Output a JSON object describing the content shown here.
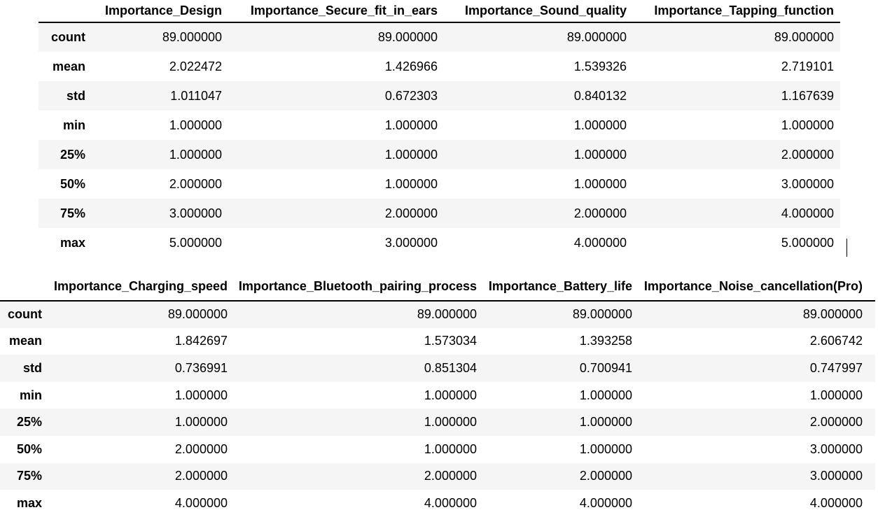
{
  "tables": [
    {
      "columns": [
        "Importance_Design",
        "Importance_Secure_fit_in_ears",
        "Importance_Sound_quality",
        "Importance_Tapping_function"
      ],
      "rows": [
        {
          "label": "count",
          "values": [
            "89.000000",
            "89.000000",
            "89.000000",
            "89.000000"
          ]
        },
        {
          "label": "mean",
          "values": [
            "2.022472",
            "1.426966",
            "1.539326",
            "2.719101"
          ]
        },
        {
          "label": "std",
          "values": [
            "1.011047",
            "0.672303",
            "0.840132",
            "1.167639"
          ]
        },
        {
          "label": "min",
          "values": [
            "1.000000",
            "1.000000",
            "1.000000",
            "1.000000"
          ]
        },
        {
          "label": "25%",
          "values": [
            "1.000000",
            "1.000000",
            "1.000000",
            "2.000000"
          ]
        },
        {
          "label": "50%",
          "values": [
            "2.000000",
            "1.000000",
            "1.000000",
            "3.000000"
          ]
        },
        {
          "label": "75%",
          "values": [
            "3.000000",
            "2.000000",
            "2.000000",
            "4.000000"
          ]
        },
        {
          "label": "max",
          "values": [
            "5.000000",
            "3.000000",
            "4.000000",
            "5.000000"
          ]
        }
      ]
    },
    {
      "columns": [
        "Importance_Charging_speed",
        "Importance_Bluetooth_pairing_process",
        "Importance_Battery_life",
        "Importance_Noise_cancellation(Pro)"
      ],
      "rows": [
        {
          "label": "count",
          "values": [
            "89.000000",
            "89.000000",
            "89.000000",
            "89.000000"
          ]
        },
        {
          "label": "mean",
          "values": [
            "1.842697",
            "1.573034",
            "1.393258",
            "2.606742"
          ]
        },
        {
          "label": "std",
          "values": [
            "0.736991",
            "0.851304",
            "0.700941",
            "0.747997"
          ]
        },
        {
          "label": "min",
          "values": [
            "1.000000",
            "1.000000",
            "1.000000",
            "1.000000"
          ]
        },
        {
          "label": "25%",
          "values": [
            "1.000000",
            "1.000000",
            "1.000000",
            "2.000000"
          ]
        },
        {
          "label": "50%",
          "values": [
            "2.000000",
            "1.000000",
            "1.000000",
            "3.000000"
          ]
        },
        {
          "label": "75%",
          "values": [
            "2.000000",
            "2.000000",
            "2.000000",
            "3.000000"
          ]
        },
        {
          "label": "max",
          "values": [
            "4.000000",
            "4.000000",
            "4.000000",
            "4.000000"
          ]
        }
      ]
    }
  ]
}
